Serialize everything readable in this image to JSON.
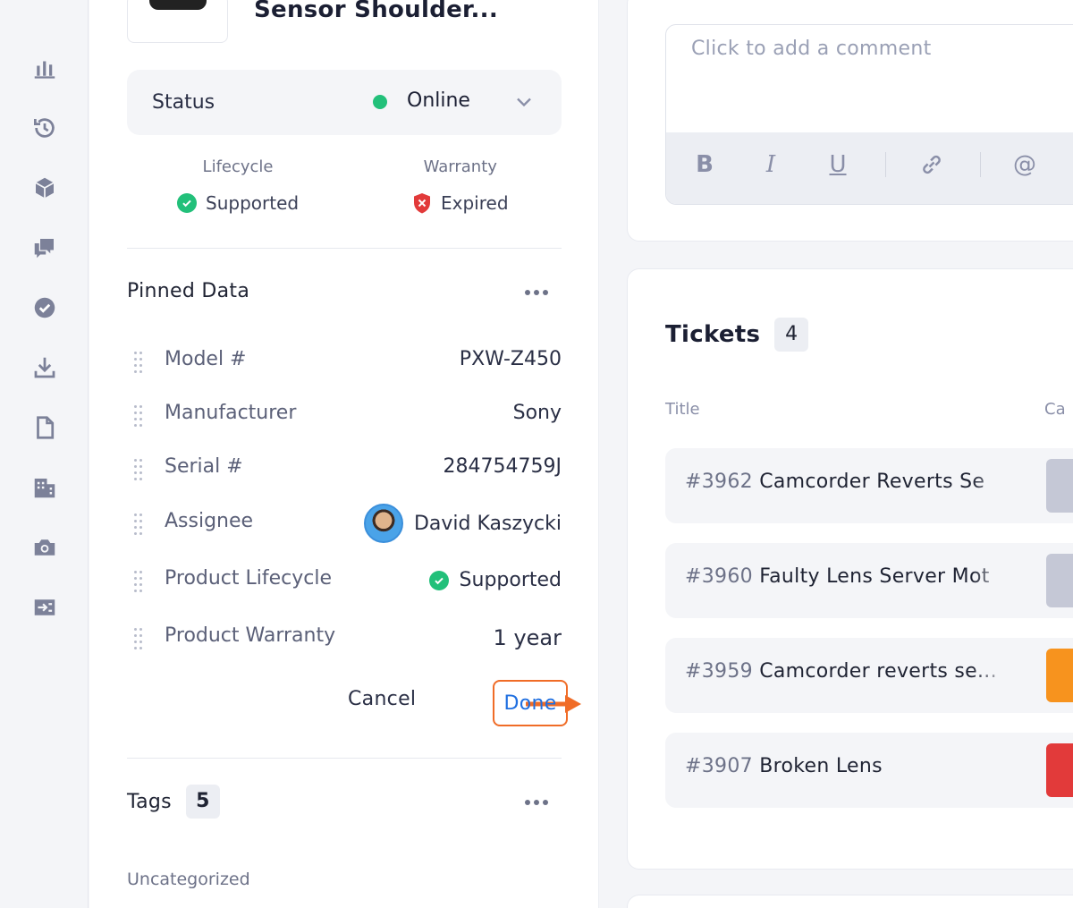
{
  "device": {
    "name": "Sensor Shoulder...",
    "status_label": "Status",
    "status_value": "Online",
    "status_color": "#22c07a",
    "lifecycle_title": "Lifecycle",
    "lifecycle_value": "Supported",
    "warranty_title": "Warranty",
    "warranty_value": "Expired"
  },
  "pinned": {
    "title": "Pinned Data",
    "rows": [
      {
        "label": "Model #",
        "value": "PXW-Z450"
      },
      {
        "label": "Manufacturer",
        "value": "Sony"
      },
      {
        "label": "Serial #",
        "value": "284754759J"
      },
      {
        "label": "Assignee",
        "value": "David Kaszycki"
      },
      {
        "label": "Product Lifecycle",
        "value": "Supported"
      },
      {
        "label": "Product Warranty",
        "value": "1 year"
      }
    ],
    "cancel_label": "Cancel",
    "done_label": "Done"
  },
  "tags": {
    "title": "Tags",
    "count": "5",
    "group_label": "Uncategorized"
  },
  "comment": {
    "placeholder": "Click to add a comment",
    "toolbar": {
      "bold": "B",
      "italic": "I",
      "underline": "U",
      "mention": "@"
    }
  },
  "tickets": {
    "title": "Tickets",
    "count": "4",
    "columns": [
      "Title",
      "Ca"
    ],
    "items": [
      {
        "number": "#3962",
        "title": "Camcorder Reverts Se",
        "category_color": "#c5c8d6"
      },
      {
        "number": "#3960",
        "title": "Faulty Lens Server Mot",
        "category_color": "#c5c8d6"
      },
      {
        "number": "#3959",
        "title": "Camcorder reverts se...",
        "category_color": "#f7931e"
      },
      {
        "number": "#3907",
        "title": "Broken Lens",
        "category_color": "#e23a3a"
      }
    ]
  },
  "accent_colors": {
    "done_outline": "#f06c27",
    "done_text": "#1f6fe0"
  }
}
